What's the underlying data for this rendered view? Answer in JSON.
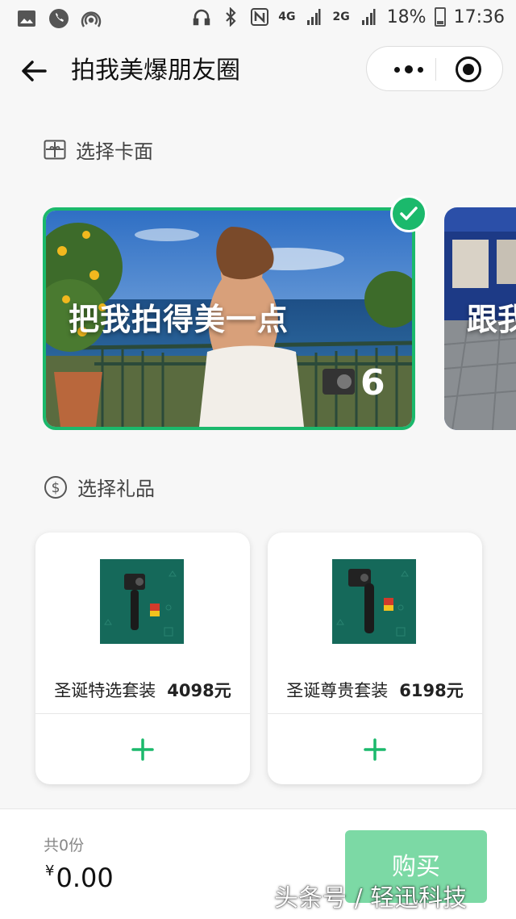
{
  "status_bar": {
    "signal_1": "4G",
    "signal_2": "2G",
    "battery_percent": "18%",
    "time": "17:36"
  },
  "nav": {
    "title": "拍我美爆朋友圈"
  },
  "card_section": {
    "title": "选择卡面",
    "cards": [
      {
        "text": "把我拍得美一点",
        "selected": true
      },
      {
        "text": "跟我",
        "selected": false
      }
    ]
  },
  "gift_section": {
    "title": "选择礼品",
    "gifts": [
      {
        "name": "圣诞特选套装",
        "price": "4098元"
      },
      {
        "name": "圣诞尊贵套装",
        "price": "6198元"
      }
    ]
  },
  "bottom": {
    "count_label": "共0份",
    "currency": "¥",
    "total": "0.00",
    "buy_label": "购买"
  },
  "watermark": "头条号 / 轻迅科技",
  "colors": {
    "accent": "#1bb96c",
    "buy_button": "#7cd9a5",
    "gift_thumb_bg": "#15695a"
  }
}
